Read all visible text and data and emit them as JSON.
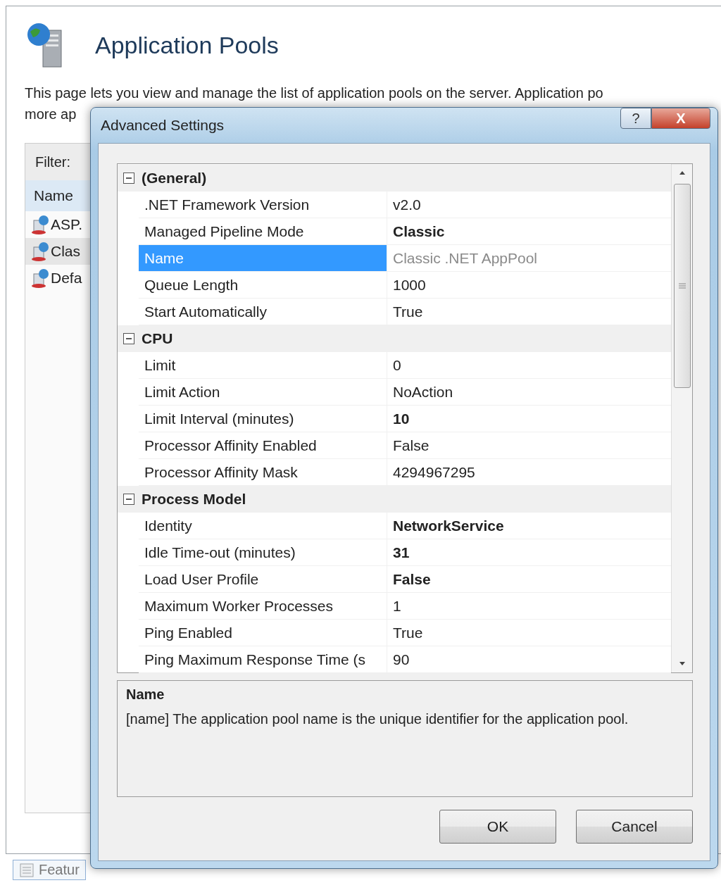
{
  "page": {
    "title": "Application Pools",
    "description_lines": [
      "This page lets you view and manage the list of application pools on the server. Application po",
      "more ap"
    ],
    "filter_label": "Filter:",
    "list_header": "Name",
    "pools": [
      {
        "name": "ASP.",
        "selected": false
      },
      {
        "name": "Clas",
        "selected": true
      },
      {
        "name": "Defa",
        "selected": false
      }
    ],
    "view_tabs": [
      {
        "label": "Featur",
        "selected": true
      }
    ]
  },
  "dialog": {
    "title": "Advanced Settings",
    "help_button": "?",
    "close_button": "X",
    "properties": [
      {
        "kind": "category",
        "label": "(General)",
        "expanded": true
      },
      {
        "kind": "property",
        "label": ".NET Framework Version",
        "value": "v2.0",
        "modified": false,
        "read_only": false,
        "selected": false
      },
      {
        "kind": "property",
        "label": "Managed Pipeline Mode",
        "value": "Classic",
        "modified": true,
        "read_only": false,
        "selected": false
      },
      {
        "kind": "property",
        "label": "Name",
        "value": "Classic .NET AppPool",
        "modified": false,
        "read_only": true,
        "selected": true
      },
      {
        "kind": "property",
        "label": "Queue Length",
        "value": "1000",
        "modified": false,
        "read_only": false,
        "selected": false
      },
      {
        "kind": "property",
        "label": "Start Automatically",
        "value": "True",
        "modified": false,
        "read_only": false,
        "selected": false
      },
      {
        "kind": "category",
        "label": "CPU",
        "expanded": true
      },
      {
        "kind": "property",
        "label": "Limit",
        "value": "0",
        "modified": false,
        "read_only": false,
        "selected": false
      },
      {
        "kind": "property",
        "label": "Limit Action",
        "value": "NoAction",
        "modified": false,
        "read_only": false,
        "selected": false
      },
      {
        "kind": "property",
        "label": "Limit Interval (minutes)",
        "value": "10",
        "modified": true,
        "read_only": false,
        "selected": false
      },
      {
        "kind": "property",
        "label": "Processor Affinity Enabled",
        "value": "False",
        "modified": false,
        "read_only": false,
        "selected": false
      },
      {
        "kind": "property",
        "label": "Processor Affinity Mask",
        "value": "4294967295",
        "modified": false,
        "read_only": false,
        "selected": false
      },
      {
        "kind": "category",
        "label": "Process Model",
        "expanded": true
      },
      {
        "kind": "property",
        "label": "Identity",
        "value": "NetworkService",
        "modified": true,
        "read_only": false,
        "selected": false
      },
      {
        "kind": "property",
        "label": "Idle Time-out (minutes)",
        "value": "31",
        "modified": true,
        "read_only": false,
        "selected": false
      },
      {
        "kind": "property",
        "label": "Load User Profile",
        "value": "False",
        "modified": true,
        "read_only": false,
        "selected": false
      },
      {
        "kind": "property",
        "label": "Maximum Worker Processes",
        "value": "1",
        "modified": false,
        "read_only": false,
        "selected": false
      },
      {
        "kind": "property",
        "label": "Ping Enabled",
        "value": "True",
        "modified": false,
        "read_only": false,
        "selected": false
      },
      {
        "kind": "property",
        "label": "Ping Maximum Response Time (s",
        "value": "90",
        "modified": false,
        "read_only": false,
        "selected": false
      }
    ],
    "description": {
      "title": "Name",
      "text": "[name] The application pool name is the unique identifier for the application pool."
    },
    "buttons": [
      "OK",
      "Cancel"
    ]
  }
}
